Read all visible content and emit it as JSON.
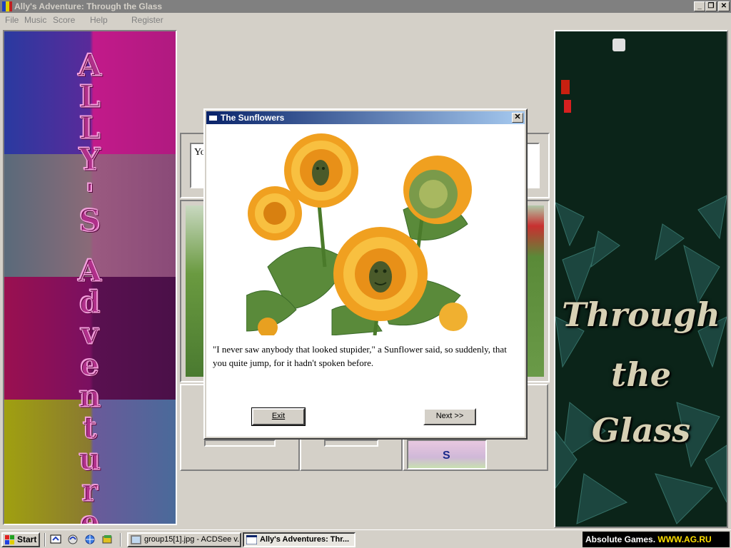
{
  "window": {
    "title": "Ally's Adventure: Through the Glass",
    "buttons": {
      "minimize": "_",
      "restore": "❐",
      "close": "✕"
    }
  },
  "menu": [
    "File",
    "Music",
    "Score",
    "Help",
    "Register"
  ],
  "left_banner": {
    "text": "ALLY'S Adventure"
  },
  "right_banner": {
    "line1": "Through",
    "line2": "the",
    "line3": "Glass"
  },
  "game": {
    "text_box": "Yo",
    "tile_letter": "S"
  },
  "dialog": {
    "title": "The Sunflowers",
    "close": "✕",
    "text": "\"I never saw anybody that looked stupider,\" a Sunflower said, so suddenly, that you quite jump, for it hadn't spoken before.",
    "exit_label": "Exit",
    "next_label": "Next >>"
  },
  "taskbar": {
    "start_label": "Start",
    "quicklaunch": [
      "desktop-icon",
      "mail-icon",
      "browser-icon",
      "channels-icon"
    ],
    "tasks": [
      {
        "label": "group15[1].jpg - ACDSee v...",
        "active": false
      },
      {
        "label": "Ally's Adventures: Thr...",
        "active": true
      }
    ],
    "ad_part1": "Absolute Games.",
    "ad_part2": "WWW.AG.RU"
  }
}
